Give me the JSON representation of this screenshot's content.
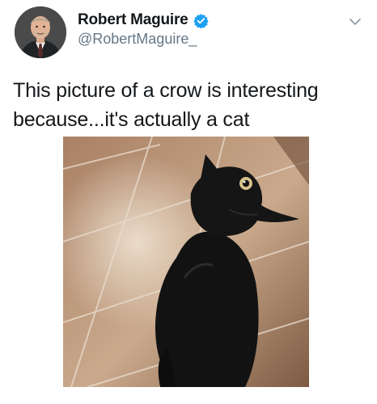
{
  "tweet": {
    "author": {
      "display_name": "Robert Maguire",
      "handle": "@RobertMaguire_",
      "verified": true
    },
    "text_line_1": "This picture of a crow is interesting",
    "text_line_2": "because...it's actually a cat"
  },
  "icons": {
    "verified": "verified-badge-icon",
    "menu": "chevron-down-icon"
  },
  "colors": {
    "verified_blue": "#1da1f2",
    "handle_gray": "#657786",
    "text_dark": "#14171a"
  }
}
